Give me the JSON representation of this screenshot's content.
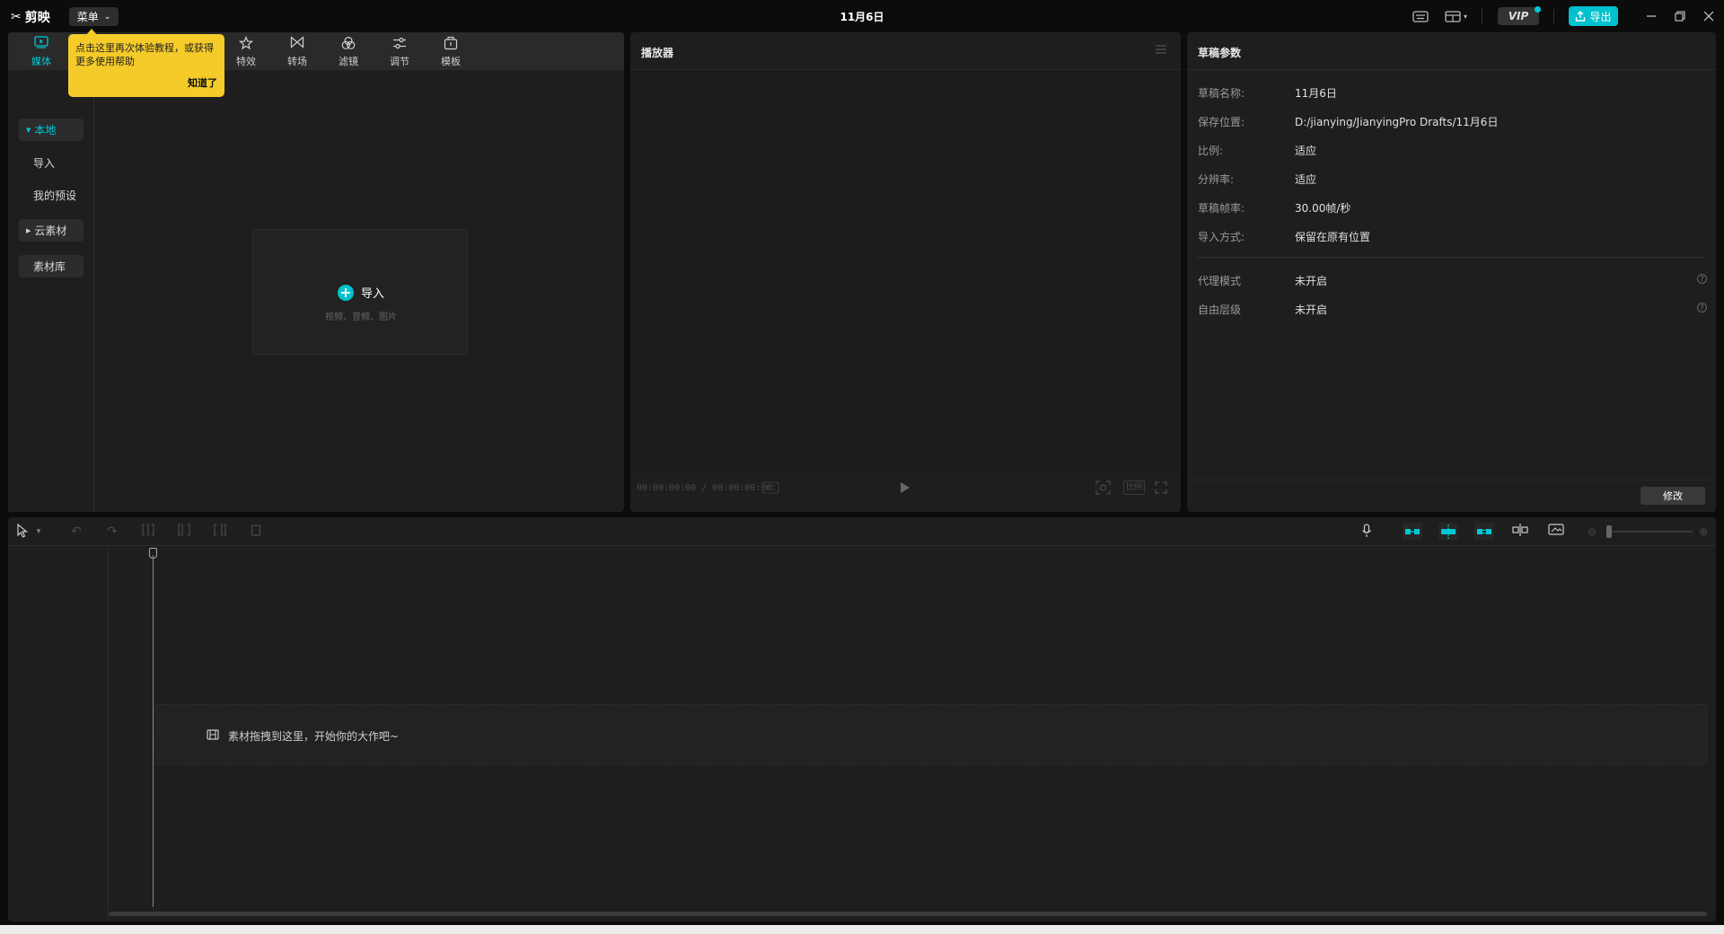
{
  "titlebar": {
    "app_name": "剪映",
    "menu_label": "菜单",
    "window_title": "11月6日",
    "vip_label": "VIP",
    "export_label": "导出"
  },
  "media_tabs": [
    {
      "label": "媒体",
      "icon": "media-play-icon",
      "active": true
    },
    {
      "label": "特效",
      "icon": "effects-star-icon"
    },
    {
      "label": "转场",
      "icon": "transition-bowtie-icon"
    },
    {
      "label": "滤镜",
      "icon": "filter-circles-icon"
    },
    {
      "label": "调节",
      "icon": "adjust-sliders-icon"
    },
    {
      "label": "模板",
      "icon": "template-icon"
    }
  ],
  "tooltip": {
    "text": "点击这里再次体验教程，或获得更多使用帮助",
    "ok_label": "知道了"
  },
  "sidebar": {
    "local": "本地",
    "import": "导入",
    "my_presets": "我的预设",
    "cloud": "云素材",
    "library": "素材库"
  },
  "import_box": {
    "label": "导入",
    "sub": "视频、音频、图片"
  },
  "player": {
    "title": "播放器",
    "timecode": "00:00:00:00 / 00:00:00:00",
    "ratio_label": "比例"
  },
  "params": {
    "title": "草稿参数",
    "rows": [
      {
        "label": "草稿名称:",
        "value": "11月6日"
      },
      {
        "label": "保存位置:",
        "value": "D:/jianying/JianyingPro Drafts/11月6日"
      },
      {
        "label": "比例:",
        "value": "适应"
      },
      {
        "label": "分辨率:",
        "value": "适应"
      },
      {
        "label": "草稿帧率:",
        "value": "30.00帧/秒"
      },
      {
        "label": "导入方式:",
        "value": "保留在原有位置"
      }
    ],
    "rows2": [
      {
        "label": "代理模式",
        "value": "未开启"
      },
      {
        "label": "自由层级",
        "value": "未开启"
      }
    ],
    "modify_label": "修改"
  },
  "timeline": {
    "drop_hint": "素材拖拽到这里，开始你的大作吧~"
  },
  "colors": {
    "accent": "#00c1cd",
    "tooltip": "#f5cb2a",
    "panel": "#1e1e1e",
    "background": "#0c0c0c"
  }
}
